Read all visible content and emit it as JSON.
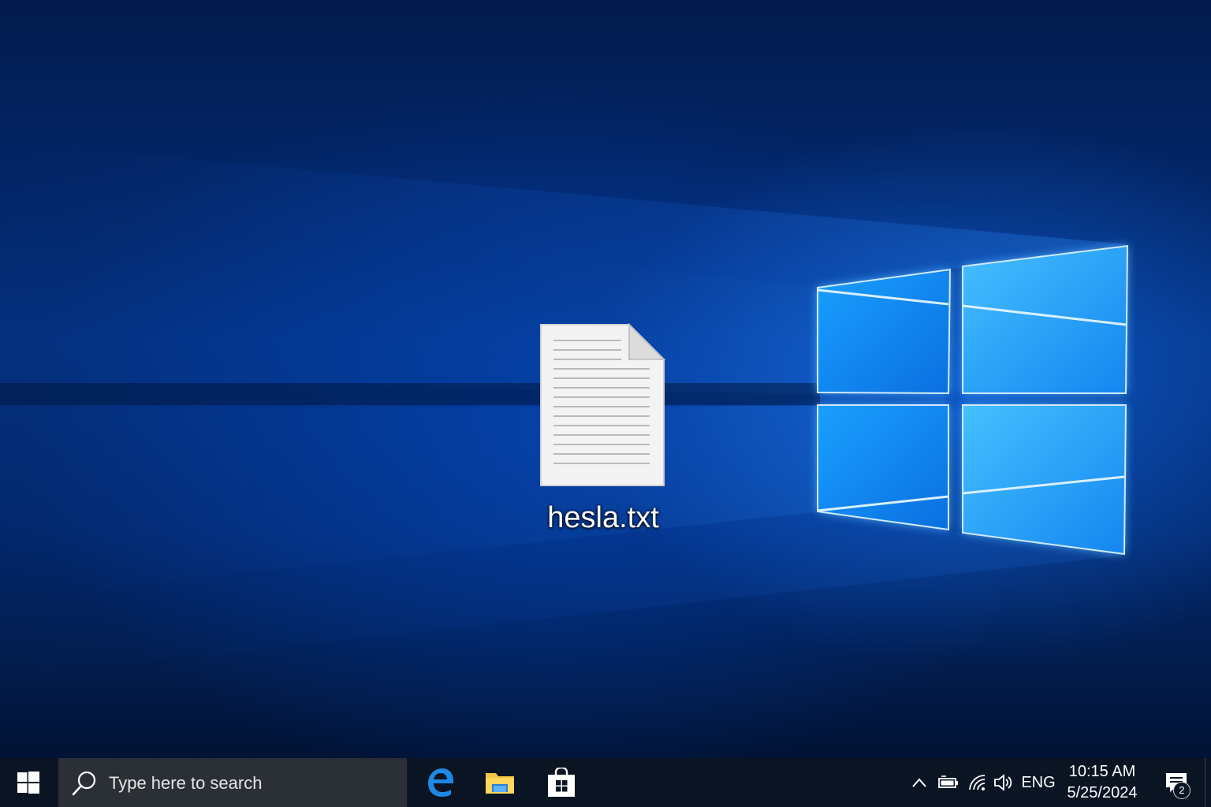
{
  "desktop": {
    "wallpaper": "windows-10-hero-blue",
    "icons": [
      {
        "label": "hesla.txt",
        "icon": "text-file-icon"
      }
    ]
  },
  "taskbar": {
    "start_icon": "windows-logo-icon",
    "search": {
      "placeholder": "Type here to search",
      "icon": "search-icon"
    },
    "pinned_apps": [
      {
        "name": "Microsoft Edge",
        "icon": "edge-icon"
      },
      {
        "name": "File Explorer",
        "icon": "folder-icon"
      },
      {
        "name": "Microsoft Store",
        "icon": "store-icon"
      }
    ],
    "tray": {
      "icons": [
        "chevron-up-icon",
        "battery-icon",
        "wifi-icon",
        "volume-icon"
      ],
      "language": "ENG",
      "time": "10:15 AM",
      "date": "5/25/2024",
      "notification_count": "2"
    }
  },
  "colors": {
    "taskbar_bg": "#0b1423",
    "search_bg": "#2b2f36",
    "accent": "#0078d7"
  }
}
